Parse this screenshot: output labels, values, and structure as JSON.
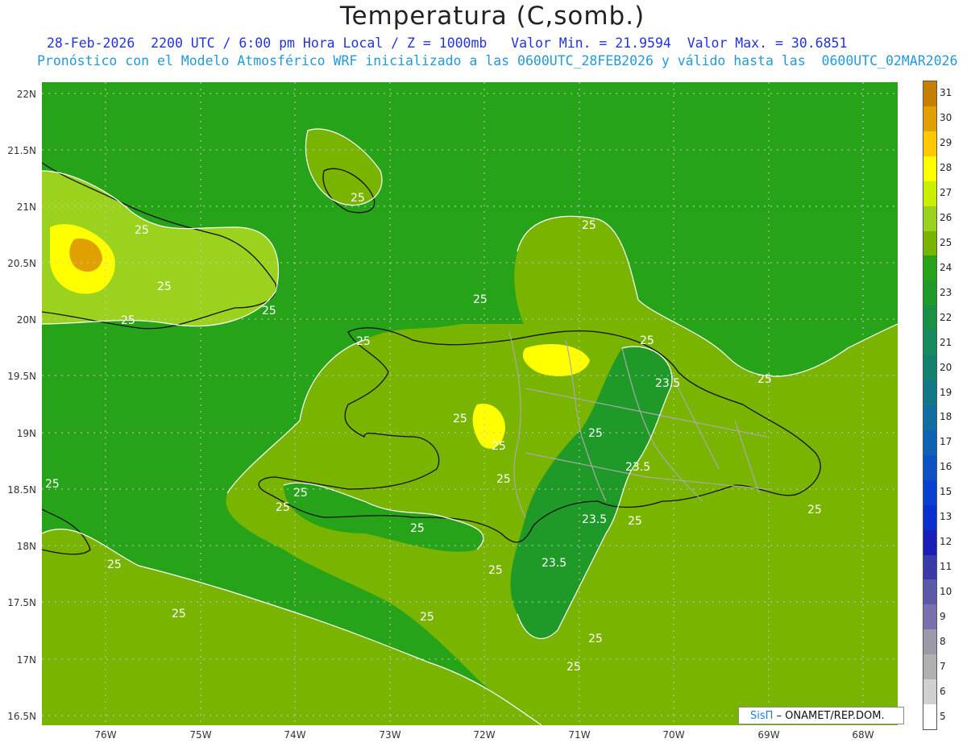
{
  "header": {
    "title": "Temperatura (C,somb.)",
    "line1": "28-Feb-2026  2200 UTC / 6:00 pm Hora Local / Z = 1000mb   Valor Min. = 21.9594  Valor Max. = 30.6851",
    "line2": "Pronóstico con el Modelo Atmosférico WRF inicializado a las 0600UTC_28FEB2026 y válido hasta las  0600UTC_02MAR2026"
  },
  "map": {
    "lat_labels": [
      "22N",
      "21.5N",
      "21N",
      "20.5N",
      "20N",
      "19.5N",
      "19N",
      "18.5N",
      "18N",
      "17.5N",
      "17N",
      "16.5N"
    ],
    "lon_labels": [
      "76W",
      "75W",
      "74W",
      "73W",
      "72W",
      "71W",
      "70W",
      "69W",
      "68W"
    ],
    "contour_labels": [
      "25",
      "25",
      "25",
      "25",
      "25",
      "25",
      "25",
      "25",
      "25",
      "25",
      "23.5",
      "25",
      "25",
      "23.5",
      "25",
      "25",
      "25",
      "25",
      "25",
      "25",
      "23.5",
      "25",
      "23.5",
      "25",
      "25",
      "25",
      "25",
      "25",
      "25",
      "25"
    ]
  },
  "colorbar": {
    "labels": [
      "31",
      "30",
      "29",
      "28",
      "27",
      "26",
      "25",
      "24",
      "23",
      "22",
      "21",
      "20",
      "19",
      "18",
      "17",
      "16",
      "15",
      "13",
      "12",
      "11",
      "10",
      "9",
      "8",
      "7",
      "6",
      "5"
    ],
    "colors": [
      "#c77f00",
      "#e0a000",
      "#ffc800",
      "#ffff00",
      "#c8f000",
      "#9bd21e",
      "#78b400",
      "#27a319",
      "#1f9a28",
      "#1a9046",
      "#178a5e",
      "#148070",
      "#127888",
      "#106ea0",
      "#0e62b4",
      "#0c52c4",
      "#0a40d0",
      "#0a2ed0",
      "#1a1eb8",
      "#3a3aa8",
      "#5a5aa8",
      "#7a70b0",
      "#9a9aa8",
      "#b0b0b0",
      "#d0d0d0",
      "#ffffff"
    ]
  },
  "footer": {
    "brand": "SisΠ",
    "org": " – ONAMET/REP.DOM."
  }
}
